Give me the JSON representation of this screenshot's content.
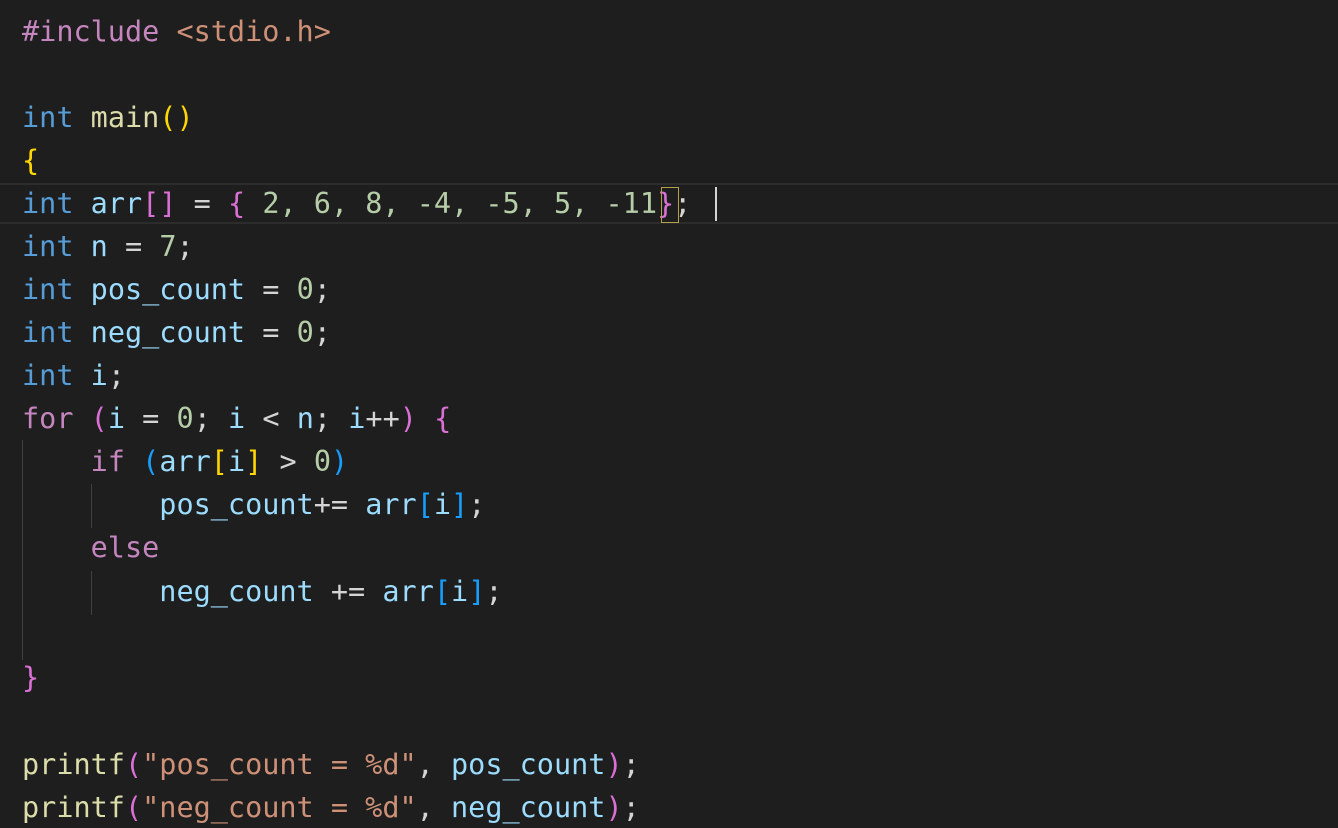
{
  "editor": {
    "lines": {
      "l1": {
        "directive": "#include",
        "header": "<stdio.h>"
      },
      "l3": {
        "type": "int",
        "name": "main",
        "parens": "()"
      },
      "l4": {
        "brace": "{"
      },
      "l5": {
        "type": "int",
        "name": "arr",
        "brackets": "[]",
        "eq": "=",
        "open": "{",
        "values": "2, 6, 8, -4, -5, 5, -11",
        "close": "}",
        "semi": ";"
      },
      "l6": {
        "type": "int",
        "name": "n",
        "eq": "=",
        "value": "7",
        "semi": ";"
      },
      "l7": {
        "type": "int",
        "name": "pos_count",
        "eq": "=",
        "value": "0",
        "semi": ";"
      },
      "l8": {
        "type": "int",
        "name": "neg_count",
        "eq": "=",
        "value": "0",
        "semi": ";"
      },
      "l9": {
        "type": "int",
        "name": "i",
        "semi": ";"
      },
      "l10": {
        "kw": "for",
        "open": "(",
        "v1": "i",
        "eq": "=",
        "zero": "0",
        "s1": ";",
        "v2": "i",
        "lt": "<",
        "v3": "n",
        "s2": ";",
        "v4": "i",
        "inc": "++",
        "close": ")",
        "brace": "{"
      },
      "l11": {
        "kw": "if",
        "open": "(",
        "arr": "arr",
        "lb": "[",
        "idx": "i",
        "rb": "]",
        "gt": ">",
        "zero": "0",
        "close": ")"
      },
      "l12": {
        "name": "pos_count",
        "op": "+=",
        "arr": "arr",
        "lb": "[",
        "idx": "i",
        "rb": "]",
        "semi": ";"
      },
      "l13": {
        "kw": "else"
      },
      "l14": {
        "name": "neg_count",
        "op": "+=",
        "arr": "arr",
        "lb": "[",
        "idx": "i",
        "rb": "]",
        "semi": ";"
      },
      "l16": {
        "brace": "}"
      },
      "l18": {
        "fn": "printf",
        "open": "(",
        "str": "\"pos_count = %d\"",
        "comma": ",",
        "arg": "pos_count",
        "close": ")",
        "semi": ";"
      },
      "l19": {
        "fn": "printf",
        "open": "(",
        "str": "\"neg_count = %d\"",
        "comma": ",",
        "arg": "neg_count",
        "close": ")",
        "semi": ";"
      }
    }
  }
}
